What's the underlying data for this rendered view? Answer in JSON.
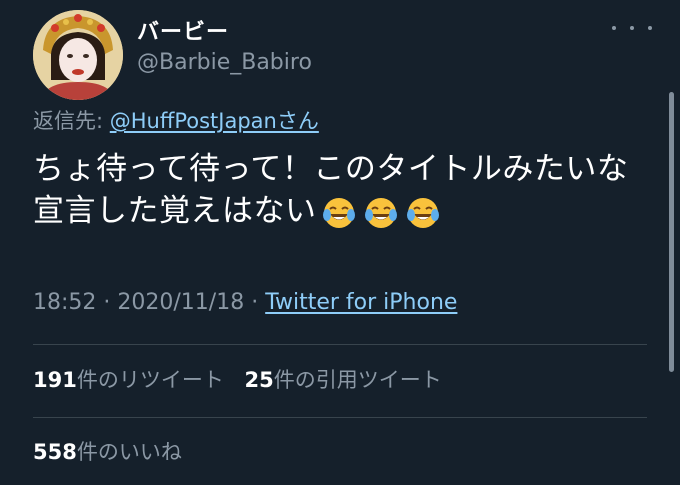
{
  "author": {
    "display_name": "バービー",
    "handle": "@Barbie_Babiro"
  },
  "reply": {
    "prefix": "返信先: ",
    "mention": "@HuffPostJapanさん"
  },
  "tweet": {
    "text": "ちょ待って待って！このタイトルみたいな宣言した覚えはない",
    "emojis": [
      "face-with-tears-of-joy",
      "face-with-tears-of-joy",
      "face-with-tears-of-joy"
    ]
  },
  "meta": {
    "time": "18:52",
    "sep1": " · ",
    "date": "2020/11/18",
    "sep2": " · ",
    "source": "Twitter for iPhone"
  },
  "stats": {
    "retweets_count": "191",
    "retweets_label": "件のリツイート",
    "quotes_count": "25",
    "quotes_label": "件の引用ツイート",
    "likes_count": "558",
    "likes_label": "件のいいね"
  },
  "colors": {
    "background": "#15202b",
    "text": "#ffffff",
    "secondary": "#8b98a5",
    "link": "#8ecdf8",
    "divider": "#38444d"
  }
}
